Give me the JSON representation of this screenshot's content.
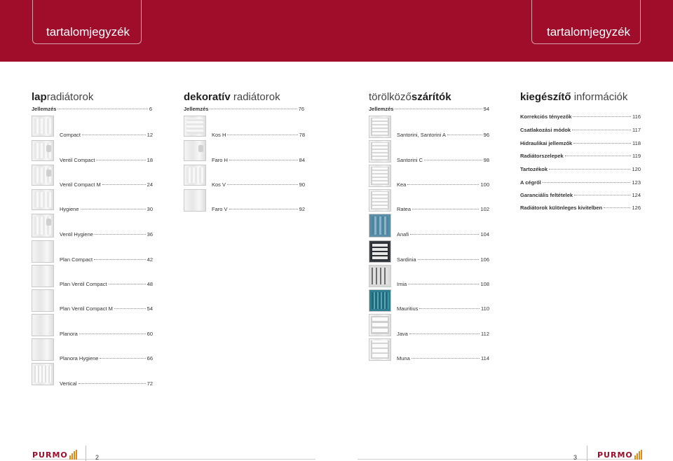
{
  "header": {
    "left_title": "tartalomjegyzék",
    "right_title": "tartalomjegyzék",
    "brand_color": "#9f0d2b"
  },
  "columns": {
    "lapradiatorok": {
      "title_bold": "lap",
      "title_light": "radiátorok",
      "intro": {
        "label": "Jellemzés",
        "page": "6"
      },
      "items": [
        {
          "label": "Compact",
          "page": "12"
        },
        {
          "label": "Ventil Compact",
          "page": "18"
        },
        {
          "label": "Ventil Compact M",
          "page": "24"
        },
        {
          "label": "Hygiene",
          "page": "30"
        },
        {
          "label": "Ventil Hygiene",
          "page": "36"
        },
        {
          "label": "Plan Compact",
          "page": "42"
        },
        {
          "label": "Plan Ventil Compact",
          "page": "48"
        },
        {
          "label": "Plan Ventil Compact M",
          "page": "54"
        },
        {
          "label": "Planora",
          "page": "60"
        },
        {
          "label": "Planora Hygiene",
          "page": "66"
        },
        {
          "label": "Vertical",
          "page": "72"
        }
      ]
    },
    "dekorativ": {
      "title_bold": "dekoratív",
      "title_light": " radiátorok",
      "intro": {
        "label": "Jellemzés",
        "page": "76"
      },
      "items": [
        {
          "label": "Kos H",
          "page": "78"
        },
        {
          "label": "Faro H",
          "page": "84"
        },
        {
          "label": "Kos V",
          "page": "90"
        },
        {
          "label": "Faro V",
          "page": "92"
        }
      ]
    },
    "torolkozo": {
      "title_light1": "törölköző",
      "title_bold": "szárítók",
      "intro": {
        "label": "Jellemzés",
        "page": "94"
      },
      "items": [
        {
          "label": "Santorini, Santorini A",
          "page": "96"
        },
        {
          "label": "Santorini C",
          "page": "98"
        },
        {
          "label": "Kea",
          "page": "100"
        },
        {
          "label": "Ratea",
          "page": "102"
        },
        {
          "label": "Anafi",
          "page": "104"
        },
        {
          "label": "Sardinia",
          "page": "106"
        },
        {
          "label": "Imia",
          "page": "108"
        },
        {
          "label": "Mauritius",
          "page": "110"
        },
        {
          "label": "Java",
          "page": "112"
        },
        {
          "label": "Muna",
          "page": "114"
        }
      ]
    },
    "kiegeszito": {
      "title_bold": "kiegészítő",
      "title_light": " információk",
      "items": [
        {
          "label": "Korrekciós tényezők",
          "page": "116"
        },
        {
          "label": "Csatlakozási módok",
          "page": "117"
        },
        {
          "label": "Hidraulikai jellemzők",
          "page": "118"
        },
        {
          "label": "Radiátorszelepek",
          "page": "119"
        },
        {
          "label": "Tartozékok",
          "page": "120"
        },
        {
          "label": "A cégről",
          "page": "123"
        },
        {
          "label": "Garanciális feltételek",
          "page": "124"
        },
        {
          "label": "Radiátorok különleges kivitelben",
          "page": "126"
        }
      ]
    }
  },
  "footer": {
    "brand": "PURMO",
    "page_left": "2",
    "page_right": "3",
    "logo_accent": "#e08a1a"
  }
}
